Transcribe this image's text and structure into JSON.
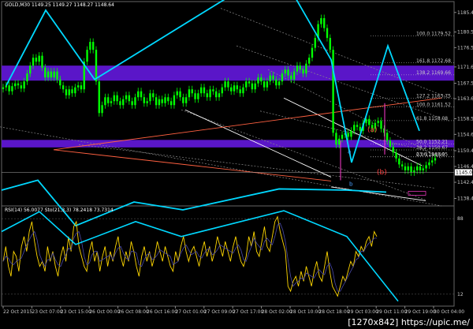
{
  "header": {
    "main_title": "GOLD,M30  1149.25 1149.27 1148.27 1148.64",
    "rsi_title": "RSI(14) 56.0077  Sto(21,3,3) 78.2418 73.7314"
  },
  "watermark": "[1270x842] https://upic.me/",
  "wave_labels": {
    "a": "(a)",
    "b": "(b)",
    "a_small": "a",
    "b_small": "b"
  },
  "current_price": "1145.00",
  "fib_labels": [
    "100.0 1179.52",
    "161.8 1172.68",
    "138.2 1169.66",
    "127.2 1163.75",
    "100.0 1161.52",
    "61.8 1158.08",
    "50.0 1152.21",
    "38.2 1150.67",
    "23.6 1148.95",
    "0.0 1148.90"
  ],
  "colors": {
    "background": "#000000",
    "candle": "#00ff00",
    "wave": "#00d8ff",
    "zone": "#5a16c8",
    "rsi": "#ffd700",
    "fib": "#d0d0d0",
    "channel": "#8a8a8a",
    "trend_red": "#ff6040",
    "vline": "#ff3ccf"
  },
  "chart_data": [
    {
      "type": "candlestick",
      "title": "GOLD,M30",
      "yticks": [
        1185.45,
        1180.5,
        1176.55,
        1171.66,
        1167.53,
        1163.63,
        1158.56,
        1154.6,
        1150.47,
        1146.48,
        1142.48,
        1138.4
      ],
      "ylim": [
        1136.7,
        1188.2
      ],
      "xticks": [
        "22 Oct 2015",
        "23 Oct 07:00",
        "23 Oct 15:00",
        "26 Oct 00:00",
        "26 Oct 08:00",
        "26 Oct 16:00",
        "27 Oct 01:00",
        "27 Oct 09:00",
        "27 Oct 17:00",
        "28 Oct 02:00",
        "28 Oct 10:00",
        "28 Oct 18:00",
        "29 Oct 03:00",
        "29 Oct 11:00",
        "29 Oct 19:00",
        "30 Oct 04:00"
      ],
      "close": [
        1166.5,
        1167.0,
        1165.5,
        1166.8,
        1167.5,
        1167.0,
        1166.2,
        1168.0,
        1170.0,
        1172.0,
        1174.0,
        1173.0,
        1174.5,
        1171.5,
        1169.0,
        1170.5,
        1169.0,
        1170.5,
        1168.5,
        1167.0,
        1166.0,
        1164.5,
        1166.0,
        1165.0,
        1166.5,
        1167.0,
        1166.0,
        1173.0,
        1176.0,
        1178.0,
        1176.0,
        1168.0,
        1160.0,
        1162.0,
        1164.0,
        1162.5,
        1163.0,
        1164.5,
        1163.0,
        1162.0,
        1163.5,
        1164.5,
        1163.0,
        1162.0,
        1164.0,
        1165.5,
        1164.0,
        1162.5,
        1163.0,
        1165.0,
        1164.0,
        1162.0,
        1163.5,
        1162.5,
        1164.0,
        1163.0,
        1162.0,
        1164.5,
        1165.5,
        1164.0,
        1162.5,
        1164.0,
        1166.0,
        1165.0,
        1163.5,
        1165.0,
        1166.5,
        1165.0,
        1164.0,
        1166.0,
        1165.5,
        1164.0,
        1165.0,
        1166.5,
        1168.0,
        1166.5,
        1165.5,
        1167.0,
        1166.0,
        1165.0,
        1166.5,
        1168.0,
        1167.5,
        1166.0,
        1167.5,
        1169.0,
        1168.0,
        1166.5,
        1168.0,
        1169.5,
        1168.5,
        1167.0,
        1168.0,
        1170.0,
        1171.0,
        1169.5,
        1168.5,
        1170.5,
        1172.0,
        1171.0,
        1170.0,
        1172.5,
        1174.0,
        1176.5,
        1179.0,
        1182.5,
        1184.0,
        1181.5,
        1179.0,
        1176.0,
        1155.0,
        1152.0,
        1153.5,
        1154.5,
        1155.0,
        1154.0,
        1155.5,
        1157.0,
        1156.5,
        1155.5,
        1157.5,
        1158.5,
        1157.0,
        1156.0,
        1157.5,
        1158.0,
        1156.0,
        1155.0,
        1153.0,
        1151.5,
        1150.0,
        1148.5,
        1147.0,
        1146.5,
        1145.5,
        1146.5,
        1145.0,
        1145.5,
        1146.5,
        1145.5,
        1146.0,
        1146.8,
        1147.5,
        1148.0,
        1148.6
      ],
      "rsi_ylim": [
        0,
        100
      ],
      "rsi_levels": [
        88,
        12
      ],
      "rsi": [
        45,
        60,
        40,
        30,
        55,
        50,
        35,
        60,
        70,
        55,
        75,
        85,
        65,
        50,
        40,
        45,
        35,
        60,
        45,
        55,
        40,
        30,
        50,
        60,
        45,
        70,
        55,
        80,
        85,
        60,
        50,
        40,
        35,
        55,
        65,
        45,
        55,
        35,
        50,
        60,
        40,
        55,
        45,
        60,
        70,
        50,
        40,
        55,
        45,
        65,
        55,
        40,
        30,
        50,
        60,
        45,
        55,
        40,
        50,
        65,
        55,
        45,
        60,
        50,
        40,
        35,
        55,
        45,
        60,
        70,
        55,
        45,
        55,
        60,
        50,
        40,
        55,
        65,
        50,
        60,
        45,
        55,
        70,
        60,
        50,
        65,
        55,
        45,
        60,
        70,
        55,
        45,
        40,
        50,
        70,
        60,
        75,
        55,
        50,
        65,
        80,
        60,
        55,
        70,
        85,
        90,
        75,
        65,
        55,
        20,
        15,
        25,
        30,
        20,
        35,
        25,
        40,
        30,
        20,
        35,
        45,
        30,
        25,
        40,
        55,
        35,
        20,
        15,
        10,
        20,
        30,
        25,
        35,
        45,
        40,
        55,
        50,
        60,
        55,
        65,
        70,
        60,
        75,
        70
      ]
    }
  ]
}
